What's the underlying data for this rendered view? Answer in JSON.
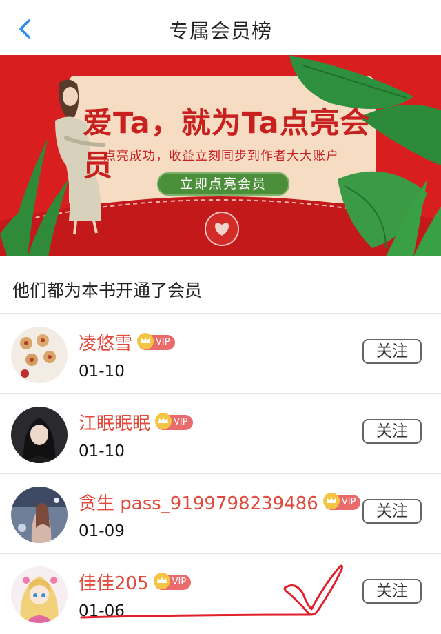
{
  "nav": {
    "title": "专属会员榜",
    "back_icon": "chevron-left-icon"
  },
  "banner": {
    "headline": "爱Ta，就为Ta点亮会员",
    "subtitle": "点亮成功，收益立刻同步到作者大大账户",
    "cta_label": "立即点亮会员",
    "colors": {
      "background": "#d81e1e",
      "card": "#f7dcc4",
      "cta": "#4b8f3a",
      "text": "#c8201e"
    }
  },
  "section": {
    "title": "他们都为本书开通了会员"
  },
  "members": [
    {
      "name": "凌悠雪",
      "badge": "VIP",
      "date": "01-10",
      "follow_label": "关注",
      "avatar_icon": "cookies-avatar-icon"
    },
    {
      "name": "江眠眠眠",
      "badge": "VIP",
      "date": "01-10",
      "follow_label": "关注",
      "avatar_icon": "girl-photo-avatar-icon"
    },
    {
      "name": "贪生 pass_9199798239486",
      "badge": "VIP",
      "date": "01-09",
      "follow_label": "关注",
      "avatar_icon": "illustration-avatar-icon"
    },
    {
      "name": "佳佳205",
      "badge": "VIP",
      "date": "01-06",
      "follow_label": "关注",
      "avatar_icon": "anime-girl-avatar-icon"
    }
  ],
  "colors": {
    "accent_name": "#e2493b",
    "vip_badge": "#e96b6b",
    "back_icon": "#2a8cf0",
    "annotation": "#e0202a"
  }
}
